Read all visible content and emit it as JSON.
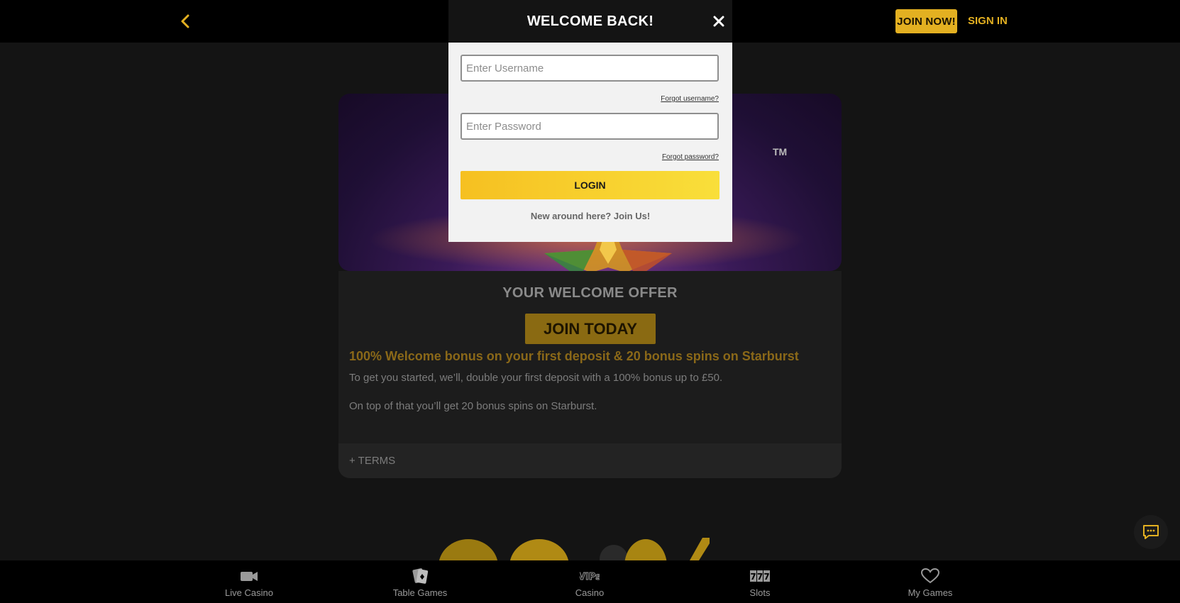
{
  "topbar": {
    "back_icon": "chevron-left-icon",
    "join_now_label": "JOIN NOW!",
    "sign_in_label": "SIGN IN",
    "accent_color": "#e3b021"
  },
  "hero": {
    "image_alt": "Starburst",
    "tm": "TM"
  },
  "offer": {
    "title": "YOUR WELCOME OFFER",
    "join_today_label": "JOIN TODAY",
    "headline": "100% Welcome bonus on your first deposit & 20 bonus spins on Starburst",
    "paragraph_1": "To get you started, we’ll, double your first deposit with a 100% bonus up to £50.",
    "paragraph_2": "On top of that you’ll get 20 bonus spins on Starburst.",
    "terms_label": "+ TERMS"
  },
  "modal": {
    "title": "WELCOME BACK!",
    "close_icon": "close-icon",
    "username_placeholder": "Enter Username",
    "username_value": "",
    "forgot_username": "Forgot username?",
    "password_placeholder": "Enter Password",
    "password_value": "",
    "forgot_password": "Forgot password?",
    "login_label": "LOGIN",
    "join_prompt": "New around here? Join Us!"
  },
  "bottom_nav": {
    "items": [
      {
        "label": "Live Casino",
        "icon": "video-camera-icon"
      },
      {
        "label": "Table Games",
        "icon": "cards-icon"
      },
      {
        "label": "Casino",
        "icon": "vips-icon"
      },
      {
        "label": "Slots",
        "icon": "slots-777-icon"
      },
      {
        "label": "My Games",
        "icon": "heart-icon"
      }
    ]
  },
  "chat": {
    "icon": "chat-bubble-icon"
  }
}
